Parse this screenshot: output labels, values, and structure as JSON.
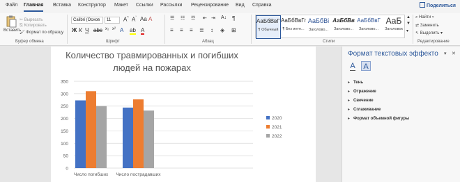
{
  "tabs": [
    {
      "label": "Файл",
      "active": false
    },
    {
      "label": "Главная",
      "active": true
    },
    {
      "label": "Вставка",
      "active": false
    },
    {
      "label": "Конструктор",
      "active": false
    },
    {
      "label": "Макет",
      "active": false
    },
    {
      "label": "Ссылки",
      "active": false
    },
    {
      "label": "Рассылки",
      "active": false
    },
    {
      "label": "Рецензирование",
      "active": false
    },
    {
      "label": "Вид",
      "active": false
    },
    {
      "label": "Справка",
      "active": false
    }
  ],
  "share_label": "Поделиться",
  "clipboard": {
    "paste": "Вставить",
    "cut": "Вырезать",
    "copy": "Копировать",
    "format_painter": "Формат по образцу",
    "group": "Буфер обмена"
  },
  "font": {
    "name": "Calibri (Основ",
    "size": "11",
    "group": "Шрифт"
  },
  "paragraph": {
    "group": "Абзац"
  },
  "styles": {
    "items": [
      {
        "preview": "АаБбВвГг,",
        "name": "¶ Обычный",
        "selected": true
      },
      {
        "preview": "АаБбВвГг,",
        "name": "¶ Без инте..."
      },
      {
        "preview": "АаБбВі",
        "name": "Заголово..."
      },
      {
        "preview": "АаБбВв",
        "name": "Заголово..."
      },
      {
        "preview": "АаБбВвГ",
        "name": "Заголово..."
      },
      {
        "preview": "АаБ",
        "name": "Заголовок"
      }
    ],
    "group": "Стили"
  },
  "editing": {
    "find": "Найти",
    "replace": "Заменить",
    "select": "Выделить",
    "group": "Редактирование"
  },
  "pane": {
    "title": "Формат текстовых эффекто",
    "items": [
      "Тень",
      "Отражение",
      "Свечение",
      "Сглаживание",
      "Формат объемной фигуры"
    ]
  },
  "colors": {
    "accent": "#2b579a",
    "series": [
      "#4472c4",
      "#ed7d31",
      "#a5a5a5"
    ]
  },
  "chart_data": {
    "type": "bar",
    "title": "Количество травмированных и погибших людей на пожарах",
    "title_lines": [
      "Количество травмированных и погибших",
      "людей на пожарах"
    ],
    "categories": [
      "Число погибших",
      "Число пострадавших"
    ],
    "series": [
      {
        "name": "2020",
        "values": [
          273,
          244
        ]
      },
      {
        "name": "2021",
        "values": [
          310,
          277
        ]
      },
      {
        "name": "2022",
        "values": [
          250,
          232
        ]
      }
    ],
    "ylim": [
      0,
      350
    ],
    "yticks": [
      "0",
      "50",
      "100",
      "150",
      "200",
      "250",
      "300",
      "350"
    ],
    "grid": true,
    "legend": "right"
  }
}
